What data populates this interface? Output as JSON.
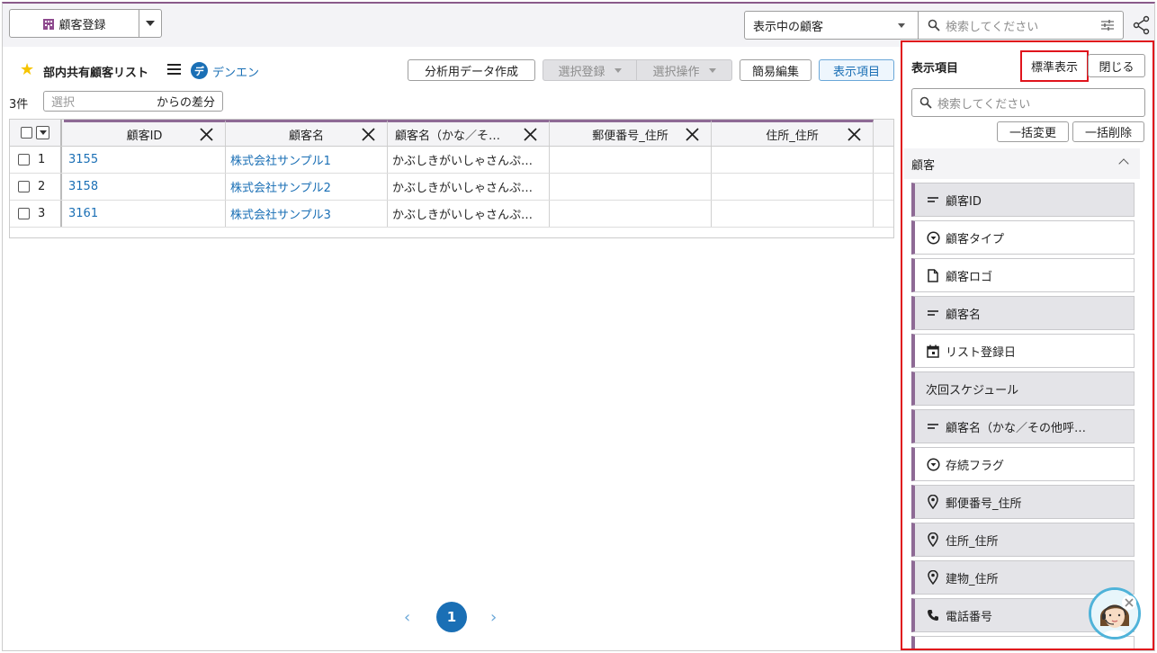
{
  "toolbar": {
    "register_label": "顧客登録",
    "view_select": "表示中の顧客",
    "search_placeholder": "検索してください"
  },
  "list": {
    "title": "部内共有顧客リスト",
    "owner_initial": "デ",
    "owner": "デンエン",
    "count": "3件",
    "diff_placeholder": "選択",
    "diff_suffix": "からの差分",
    "actions": {
      "analysis": "分析用データ作成",
      "select_register": "選択登録",
      "select_operation": "選択操作",
      "quick_edit": "簡易編集",
      "display_items": "表示項目"
    }
  },
  "table": {
    "columns": [
      "顧客ID",
      "顧客名",
      "顧客名（かな／そ…",
      "郵便番号_住所",
      "住所_住所"
    ],
    "rows": [
      {
        "num": "1",
        "id": "3155",
        "name": "株式会社サンプル1",
        "kana": "かぶしきがいしゃさんぷ…",
        "zip": "",
        "addr": ""
      },
      {
        "num": "2",
        "id": "3158",
        "name": "株式会社サンプル2",
        "kana": "かぶしきがいしゃさんぷ…",
        "zip": "",
        "addr": ""
      },
      {
        "num": "3",
        "id": "3161",
        "name": "株式会社サンプル3",
        "kana": "かぶしきがいしゃさんぷ…",
        "zip": "",
        "addr": ""
      }
    ]
  },
  "pagination": {
    "current": "1",
    "prev": "‹",
    "next": "›"
  },
  "panel": {
    "title": "表示項目",
    "standard": "標準表示",
    "close": "閉じる",
    "search_placeholder": "検索してください",
    "bulk_change": "一括変更",
    "bulk_delete": "一括削除",
    "section": "顧客",
    "items": [
      {
        "label": "顧客ID",
        "icon": "text-lines-icon",
        "active": true
      },
      {
        "label": "顧客タイプ",
        "icon": "dropdown-circle-icon",
        "active": false
      },
      {
        "label": "顧客ロゴ",
        "icon": "file-icon",
        "active": false
      },
      {
        "label": "顧客名",
        "icon": "text-lines-icon",
        "active": true
      },
      {
        "label": "リスト登録日",
        "icon": "calendar-icon",
        "active": false
      },
      {
        "label": "次回スケジュール",
        "icon": "",
        "active": true
      },
      {
        "label": "顧客名（かな／その他呼…",
        "icon": "text-lines-icon",
        "active": true
      },
      {
        "label": "存続フラグ",
        "icon": "dropdown-circle-icon",
        "active": false
      },
      {
        "label": "郵便番号_住所",
        "icon": "location-pin-icon",
        "active": true
      },
      {
        "label": "住所_住所",
        "icon": "location-pin-icon",
        "active": true
      },
      {
        "label": "建物_住所",
        "icon": "location-pin-icon",
        "active": true
      },
      {
        "label": "電話番号",
        "icon": "phone-icon",
        "active": true
      }
    ]
  },
  "colors": {
    "accent": "#1a6fb5",
    "column_bar": "#8e6a95",
    "highlight": "#e0141c"
  }
}
